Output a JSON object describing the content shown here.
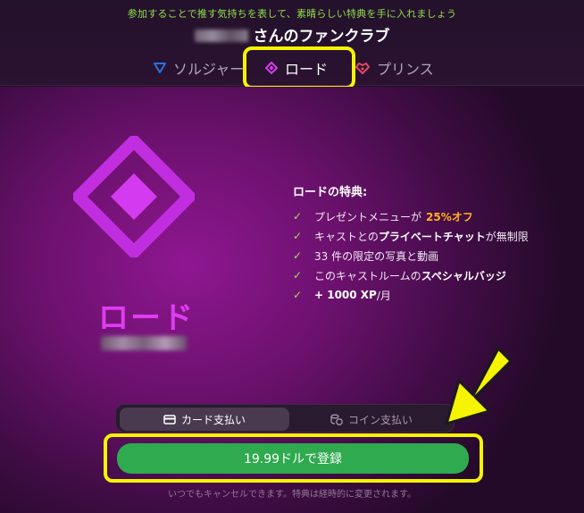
{
  "promo_text": "参加することで推す気持ちを表して、素晴らしい特典を手に入れましょう",
  "club": {
    "title_suffix": "さんのファンクラブ"
  },
  "tabs": [
    {
      "label": "ソルジャー",
      "icon": "triangle-icon",
      "color": "#2f6fe0"
    },
    {
      "label": "ロード",
      "icon": "diamond-icon",
      "color": "#d93cf0",
      "selected": true
    },
    {
      "label": "プリンス",
      "icon": "heart-diamond-icon",
      "color": "#e24a63"
    }
  ],
  "tier": {
    "name": "ロード",
    "benefits_title": "ロードの特典:",
    "benefits": [
      {
        "pre": "プレゼントメニューが",
        "accent": "25%オフ"
      },
      {
        "pre": "キャストとの",
        "bold": "プライベートチャット",
        "post": "が無制限"
      },
      {
        "text": "33 件の限定の写真と動画"
      },
      {
        "pre": "このキャストルームの",
        "bold": "スペシャルバッジ"
      },
      {
        "bold": "+ 1000 XP",
        "post": " /月"
      }
    ]
  },
  "payment": {
    "card_label": "カード支払い",
    "coin_label": "コイン支払い",
    "selected": "card"
  },
  "subscribe_label": "19.99ドルで登録",
  "footnote": "いつでもキャンセルできます。特典は経時的に変更されます。",
  "colors": {
    "accent_magenta": "#df3cf1",
    "highlight": "#f6f400",
    "button_green": "#2faa4f",
    "check_green": "#9fe05a",
    "discount_orange": "#ffb21f"
  }
}
